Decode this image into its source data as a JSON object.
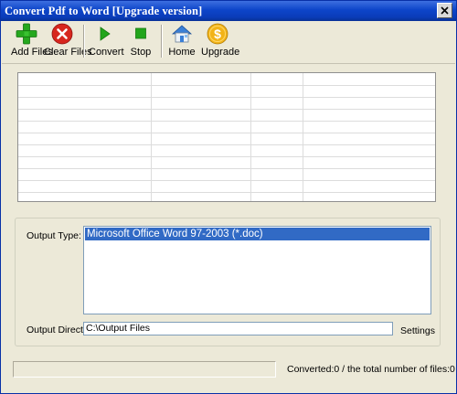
{
  "window": {
    "title": "Convert Pdf to Word [Upgrade version]"
  },
  "toolbar": {
    "add_files": "Add Files",
    "clear_files": "Clear Files",
    "convert": "Convert",
    "stop": "Stop",
    "home": "Home",
    "upgrade": "Upgrade"
  },
  "icons": {
    "add_files": "plus-icon",
    "clear_files": "red-x-circle-icon",
    "convert": "play-icon",
    "stop": "stop-square-icon",
    "home": "house-icon",
    "upgrade": "dollar-coin-icon"
  },
  "output": {
    "type_label": "Output Type:",
    "type_options": [
      "Microsoft Office Word 97-2003 (*.doc)"
    ],
    "directory_label": "Output Directory:",
    "directory_value": "C:\\Output Files",
    "settings_label": "Settings"
  },
  "status": {
    "converted_text": "Converted:0  /  the total number of files:0"
  },
  "colors": {
    "titlebar": "#0a3cb9",
    "selection": "#316ac5",
    "window_bg": "#ece9d8"
  }
}
